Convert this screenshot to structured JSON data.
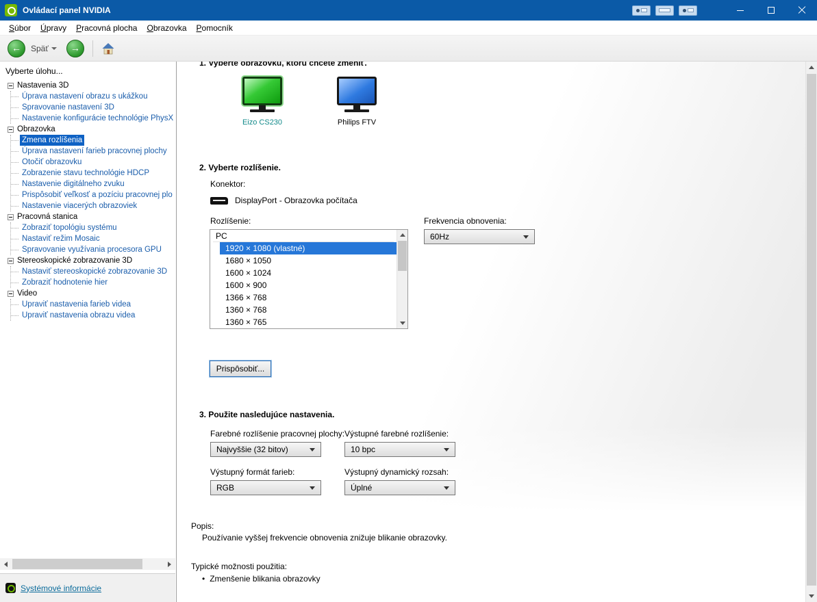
{
  "window": {
    "title": "Ovládací panel NVIDIA"
  },
  "icons": {
    "back_arrow": "←",
    "forward_arrow": "→"
  },
  "menu": {
    "items": [
      "Súbor",
      "Úpravy",
      "Pracovná plocha",
      "Obrazovka",
      "Pomocník"
    ]
  },
  "toolbar": {
    "back_label": "Späť"
  },
  "sidebar": {
    "header": "Vyberte úlohu...",
    "selected_item": "Zmena rozlíšenia",
    "categories": [
      {
        "label": "Nastavenia 3D",
        "items": [
          "Úprava nastavení obrazu s ukážkou",
          "Spravovanie nastavení 3D",
          "Nastavenie konfigurácie technológie PhysX"
        ]
      },
      {
        "label": "Obrazovka",
        "items": [
          "Zmena rozlíšenia",
          "Úprava nastavení farieb pracovnej plochy",
          "Otočiť obrazovku",
          "Zobrazenie stavu technológie HDCP",
          "Nastavenie digitálneho zvuku",
          "Prispôsobiť veľkosť a pozíciu pracovnej plo",
          "Nastavenie viacerých obrazoviek"
        ]
      },
      {
        "label": "Pracovná stanica",
        "items": [
          "Zobraziť topológiu systému",
          "Nastaviť režim Mosaic",
          "Spravovanie využívania procesora GPU"
        ]
      },
      {
        "label": "Stereoskopické zobrazovanie 3D",
        "items": [
          "Nastaviť stereoskopické zobrazovanie 3D",
          "Zobraziť hodnotenie hier"
        ]
      },
      {
        "label": "Video",
        "items": [
          "Upraviť nastavenia farieb videa",
          "Upraviť nastavenia obrazu videa"
        ]
      }
    ],
    "footer_link": "Systémové informácie"
  },
  "main": {
    "section1": {
      "title": "1. Vyberte obrazovku, ktorú chcete zmeniť.",
      "displays": [
        {
          "name": "Eizo CS230",
          "selected": true
        },
        {
          "name": "Philips FTV",
          "selected": false
        }
      ]
    },
    "section2": {
      "title": "2. Vyberte rozlíšenie.",
      "connector_label": "Konektor:",
      "connector_value": "DisplayPort - Obrazovka počítača",
      "resolution_label": "Rozlíšenie:",
      "group_label": "PC",
      "resolutions": [
        "1920 × 1080 (vlastné)",
        "1680 × 1050",
        "1600 × 1024",
        "1600 × 900",
        "1366 × 768",
        "1360 × 768",
        "1360 × 765"
      ],
      "selected_resolution": "1920 × 1080 (vlastné)",
      "refresh_label": "Frekvencia obnovenia:",
      "refresh_value": "60Hz",
      "customize_button": "Prispôsobiť..."
    },
    "section3": {
      "title": "3. Použite nasledujúce nastavenia.",
      "fields": [
        {
          "name": "desktop-color-depth",
          "label": "Farebné rozlíšenie pracovnej plochy:",
          "value": "Najvyššie (32 bitov)"
        },
        {
          "name": "output-color-depth",
          "label": "Výstupné farebné rozlíšenie:",
          "value": "10 bpc"
        },
        {
          "name": "output-color-format",
          "label": "Výstupný formát farieb:",
          "value": "RGB"
        },
        {
          "name": "output-dynamic-range",
          "label": "Výstupný dynamický rozsah:",
          "value": "Úplné"
        }
      ]
    },
    "description": {
      "label": "Popis:",
      "text": "Používanie vyššej frekvencie obnovenia znižuje blikanie obrazovky.",
      "usage_label": "Typické možnosti použitia:",
      "usage_items": [
        "Zmenšenie blikania obrazovky"
      ]
    }
  },
  "colors": {
    "titlebar": "#0b5aa7",
    "selection": "#2677d8",
    "tree_selection": "#0f62c4",
    "tree_link": "#1a5dab",
    "nvidia_green": "#76b900"
  }
}
